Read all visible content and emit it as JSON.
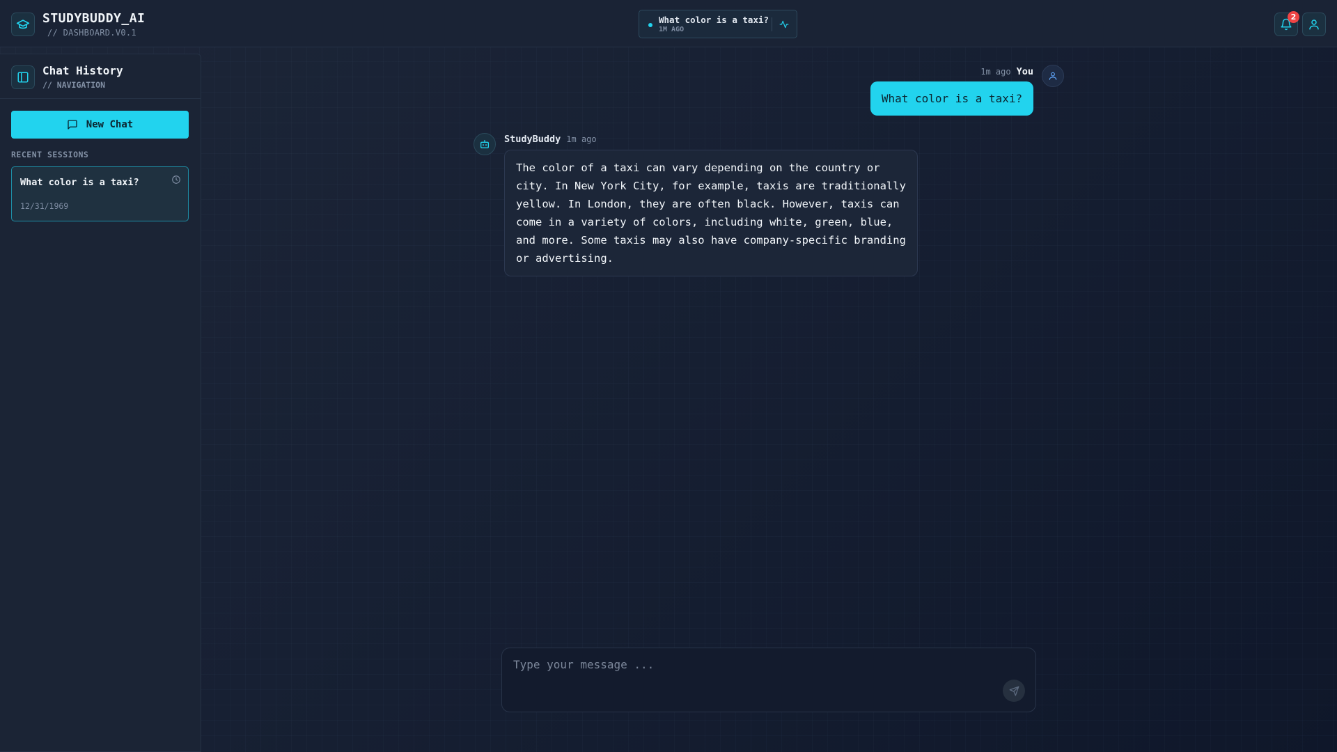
{
  "app": {
    "brand_title": "STUDYBUDDY_AI",
    "brand_sub": "// DASHBOARD.V0.1"
  },
  "header": {
    "active_session_title": "What color is a taxi?",
    "active_session_time": "1M AGO",
    "notification_count": "2"
  },
  "sidebar": {
    "title": "Chat History",
    "subtitle": "// NAVIGATION",
    "new_chat_label": "New Chat",
    "recent_label": "RECENT SESSIONS",
    "sessions": [
      {
        "title": "What color is a taxi?",
        "date": "12/31/1969"
      }
    ]
  },
  "chat": {
    "messages": [
      {
        "role": "user",
        "author": "You",
        "time": "1m ago",
        "text": "What color is a taxi?"
      },
      {
        "role": "assistant",
        "author": "StudyBuddy",
        "time": "1m ago",
        "text": "The color of a taxi can vary depending on the country or city. In New York City, for example, taxis are traditionally yellow. In London, they are often black. However, taxis can come in a variety of colors, including white, green, blue, and more. Some taxis may also have company-specific branding or advertising."
      }
    ]
  },
  "composer": {
    "placeholder": "Type your message ...",
    "value": ""
  },
  "colors": {
    "accent": "#22d3ee",
    "background": "#141d2e",
    "panel": "#1b2435",
    "badge": "#ef4444"
  }
}
